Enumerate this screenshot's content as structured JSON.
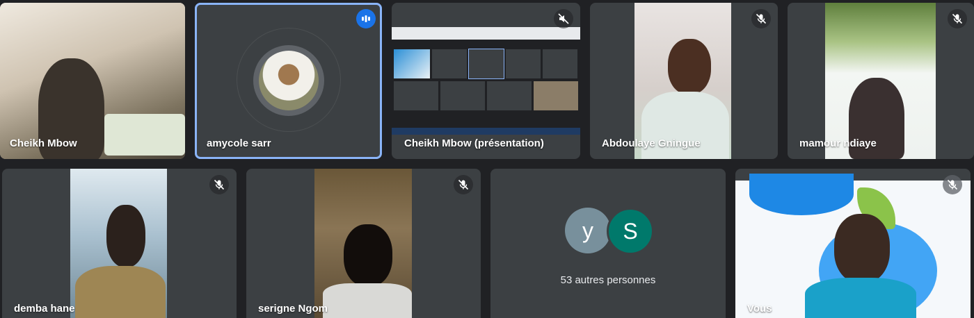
{
  "participants": {
    "t1": {
      "name": "Cheikh Mbow"
    },
    "t2": {
      "name": "amycole sarr"
    },
    "t3": {
      "name": "Cheikh Mbow (présentation)"
    },
    "t4": {
      "name": "Abdoulaye Gningue"
    },
    "t5": {
      "name": "mamour ndiaye"
    },
    "t6": {
      "name": "demba hane"
    },
    "t7": {
      "name": "serigne Ngom"
    },
    "t8": {
      "others": "53 autres personnes",
      "initial_a": "y",
      "initial_b": "S"
    },
    "t9": {
      "name": "Vous"
    }
  },
  "colors": {
    "tile_bg": "#3c4043",
    "page_bg": "#202124",
    "speaking_outline": "#8ab4f8",
    "speaking_badge": "#1a73e8",
    "avatar_y": "#78909c",
    "avatar_s": "#00796b"
  },
  "icons": {
    "mic": "mic-off-icon",
    "volume": "volume-off-icon",
    "speaking": "audio-level-icon"
  }
}
